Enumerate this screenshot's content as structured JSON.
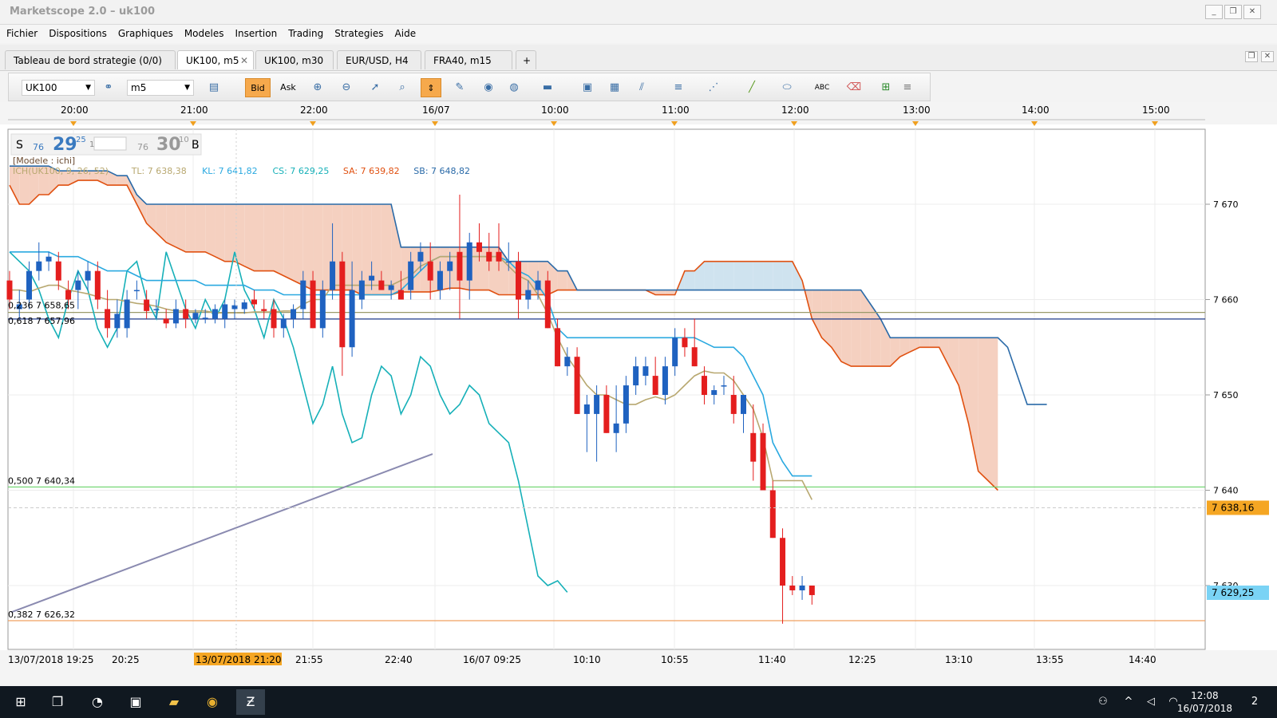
{
  "window": {
    "title": "Marketscope 2.0 – uk100",
    "min_symbol": "_",
    "restore_symbol": "❐",
    "close_symbol": "✕"
  },
  "menu": [
    "Fichier",
    "Dispositions",
    "Graphiques",
    "Modeles",
    "Insertion",
    "Trading",
    "Strategies",
    "Aide"
  ],
  "tabs": [
    {
      "label": "Tableau de bord strategie (0/0)",
      "active": false
    },
    {
      "label": "UK100, m5",
      "active": true,
      "close": "✕"
    },
    {
      "label": "UK100, m30",
      "active": false
    },
    {
      "label": "EUR/USD, H4",
      "active": false
    },
    {
      "label": "FRA40, m15",
      "active": false
    }
  ],
  "add_tab": "+",
  "toolbar": {
    "instrument": "UK100",
    "timeframe": "m5",
    "bid_label": "Bid",
    "ask_label": "Ask"
  },
  "quote": {
    "sell_label": "S",
    "sell_small": "76",
    "sell_big": "29",
    "sell_sup": "25",
    "spread": "1",
    "buy_small": "76",
    "buy_big": "30",
    "buy_sup": "10",
    "buy_label": "B"
  },
  "model_label": "[Modele : ichi]",
  "indicator": {
    "name": "ICH(UK100, 9, 26, 52)",
    "tl": "TL: 7 638,38",
    "kl": "KL: 7 641,82",
    "cs": "CS: 7 629,25",
    "sa": "SA: 7 639,82",
    "sb": "SB: 7 648,82"
  },
  "fib_labels": {
    "f236": "0,236 7 658,65",
    "f618": "0,618 7 657,96",
    "f500": "0,500 7 640,34",
    "f382": "0,382 7 626,32"
  },
  "price_badges": {
    "last": "7 638,16",
    "cs": "7 629,25"
  },
  "colors": {
    "bull": "#1f62c0",
    "bear": "#e41e1e",
    "tenkan": "#b8a870",
    "kijun": "#2aa9e0",
    "chikou": "#16b0b8",
    "spanA": "#e05010",
    "spanB": "#2a6aa8",
    "cloud_bear": "#f5d0c0",
    "cloud_bull": "#cfe3ef",
    "fib500": "#6ad36a",
    "fib382": "#f0a060",
    "fib_blue": "#1e3a8a",
    "fib_olive": "#9a9a6a",
    "trend": "#8a8ab0",
    "last_badge": "#f5a623",
    "cs_badge": "#7ad3f5"
  },
  "top_axis": [
    "20:00",
    "21:00",
    "22:00",
    "16/07",
    "10:00",
    "11:00",
    "12:00",
    "13:00",
    "14:00",
    "15:00"
  ],
  "bottom_axis": [
    "13/07/2018 19:25",
    "20:25",
    "13/07/2018 21:20",
    "21:55",
    "22:40",
    "16/07 09:25",
    "10:10",
    "10:55",
    "11:40",
    "12:25",
    "13:10",
    "13:55",
    "14:40"
  ],
  "chart_data": {
    "type": "candlestick",
    "instrument": "UK100",
    "timeframe": "m5",
    "ylim": [
      7622,
      7680
    ],
    "y_ticks": [
      "7 670",
      "7 660",
      "7 650",
      "7 640",
      "7 630"
    ],
    "y_tick_values": [
      7670,
      7660,
      7650,
      7640,
      7630
    ],
    "fib_levels": [
      7658.65,
      7657.96,
      7640.34,
      7626.32
    ],
    "candles": [
      [
        7662,
        7663,
        7659,
        7660
      ],
      [
        7659,
        7661,
        7658,
        7659.5
      ],
      [
        7660,
        7664,
        7659,
        7663
      ],
      [
        7663,
        7666,
        7662,
        7664
      ],
      [
        7664,
        7665,
        7663,
        7664.5
      ],
      [
        7664,
        7665,
        7661,
        7662
      ],
      [
        7661,
        7662,
        7659,
        7660
      ],
      [
        7661,
        7663,
        7659,
        7662
      ],
      [
        7662,
        7664,
        7661,
        7663
      ],
      [
        7663,
        7664,
        7659,
        7660
      ],
      [
        7659,
        7661,
        7656,
        7657
      ],
      [
        7657,
        7660,
        7656,
        7658.5
      ],
      [
        7657,
        7661,
        7656,
        7660
      ],
      [
        7661,
        7662,
        7660,
        7661
      ],
      [
        7660,
        7661,
        7658,
        7658.8
      ],
      [
        7659,
        7660,
        7658,
        7659
      ],
      [
        7658,
        7659,
        7657,
        7657.5
      ],
      [
        7657.5,
        7660,
        7657,
        7659
      ],
      [
        7659,
        7660,
        7657,
        7658
      ],
      [
        7658,
        7659,
        7657.5,
        7658.6
      ],
      [
        7658,
        7659,
        7657.5,
        7658.1
      ],
      [
        7658,
        7659.5,
        7657.5,
        7659
      ],
      [
        7658,
        7660,
        7657,
        7659.5
      ],
      [
        7659,
        7660,
        7658,
        7659.4
      ],
      [
        7659,
        7660,
        7658.5,
        7659.7
      ],
      [
        7660,
        7661,
        7659,
        7659.5
      ],
      [
        7659,
        7660,
        7658,
        7658.8
      ],
      [
        7659,
        7660,
        7656,
        7657
      ],
      [
        7657,
        7658.5,
        7656,
        7658
      ],
      [
        7658,
        7659.5,
        7657,
        7659
      ],
      [
        7659,
        7663,
        7658,
        7662
      ],
      [
        7662,
        7663,
        7657,
        7657
      ],
      [
        7657,
        7662,
        7656,
        7661
      ],
      [
        7661,
        7668,
        7660,
        7664
      ],
      [
        7664,
        7665,
        7652,
        7655
      ],
      [
        7655,
        7664,
        7654,
        7661
      ],
      [
        7660,
        7663,
        7659,
        7662
      ],
      [
        7662,
        7664,
        7661,
        7662.5
      ],
      [
        7662,
        7663,
        7661,
        7661
      ],
      [
        7661,
        7662,
        7660,
        7661.5
      ],
      [
        7661,
        7663,
        7660,
        7660
      ],
      [
        7661,
        7665,
        7660,
        7664
      ],
      [
        7664,
        7666,
        7663,
        7665
      ],
      [
        7664,
        7666,
        7660,
        7662
      ],
      [
        7661,
        7664,
        7660,
        7663
      ],
      [
        7663,
        7665,
        7661,
        7664
      ],
      [
        7665,
        7671,
        7658,
        7662
      ],
      [
        7662,
        7667,
        7660,
        7666
      ],
      [
        7666,
        7668,
        7664,
        7665
      ],
      [
        7665,
        7667,
        7663,
        7664
      ],
      [
        7665,
        7668,
        7663,
        7664
      ],
      [
        7664,
        7666,
        7663,
        7664
      ],
      [
        7664,
        7665,
        7658,
        7660
      ],
      [
        7660,
        7662,
        7659,
        7661
      ],
      [
        7661,
        7663,
        7660,
        7662
      ],
      [
        7662,
        7663,
        7657,
        7657
      ],
      [
        7657,
        7658,
        7653,
        7653
      ],
      [
        7653,
        7655,
        7652,
        7654
      ],
      [
        7654,
        7655,
        7648,
        7648
      ],
      [
        7648,
        7650,
        7644,
        7649
      ],
      [
        7648,
        7651,
        7643,
        7650
      ],
      [
        7650,
        7651,
        7646,
        7646
      ],
      [
        7646,
        7651,
        7644,
        7647
      ],
      [
        7647,
        7652,
        7646,
        7651
      ],
      [
        7651,
        7654,
        7650,
        7653
      ],
      [
        7652,
        7654,
        7651,
        7653
      ],
      [
        7652,
        7654,
        7650,
        7650
      ],
      [
        7650,
        7654,
        7649,
        7653
      ],
      [
        7653,
        7657,
        7652,
        7656
      ],
      [
        7656,
        7657,
        7654,
        7655
      ],
      [
        7655,
        7658,
        7653,
        7653
      ],
      [
        7652,
        7653,
        7649,
        7650
      ],
      [
        7650,
        7651,
        7649,
        7650.5
      ],
      [
        7651,
        7652,
        7650,
        7651
      ],
      [
        7650,
        7652,
        7647,
        7648
      ],
      [
        7648,
        7650,
        7646,
        7650
      ],
      [
        7646,
        7649,
        7641,
        7643
      ],
      [
        7646,
        7647,
        7640,
        7640
      ],
      [
        7640,
        7641,
        7635,
        7635
      ],
      [
        7635,
        7636,
        7626,
        7630
      ],
      [
        7630,
        7631,
        7629,
        7629.5
      ],
      [
        7629.5,
        7631,
        7628.5,
        7630
      ],
      [
        7630,
        7630,
        7628,
        7629
      ]
    ],
    "tenkan_sen": [
      7661,
      7661,
      7660.8,
      7661.2,
      7661.5,
      7661.5,
      7661,
      7660.8,
      7660.6,
      7660.3,
      7660,
      7660,
      7659.8,
      7659.6,
      7659.5,
      7659.3,
      7659,
      7658.8,
      7658.8,
      7658.8,
      7658.8,
      7658.6,
      7658.6,
      7658.6,
      7658.6,
      7658.7,
      7658.7,
      7658.7,
      7658.8,
      7658.8,
      7659.5,
      7660,
      7660,
      7661.5,
      7661.5,
      7661.5,
      7661.5,
      7661.5,
      7661.5,
      7661.5,
      7662,
      7662.5,
      7663.5,
      7664,
      7664.5,
      7664.5,
      7664.5,
      7664.5,
      7664.5,
      7664.5,
      7664.5,
      7663.5,
      7662.5,
      7662,
      7660.5,
      7658.5,
      7656,
      7654,
      7652.5,
      7651,
      7650,
      7650,
      7649.5,
      7649,
      7649,
      7649.5,
      7649.8,
      7649.5,
      7650,
      7651,
      7652,
      7652.5,
      7652.3,
      7652.3,
      7651.5,
      7650,
      7648.5,
      7645.5,
      7641,
      7641,
      7641,
      7641,
      7639
    ],
    "kijun_sen": [
      7665,
      7665,
      7665,
      7665,
      7665,
      7664.5,
      7664.5,
      7664.5,
      7664,
      7663.5,
      7663,
      7663,
      7663,
      7662.5,
      7662,
      7662,
      7662,
      7662,
      7662,
      7662,
      7661.5,
      7661.5,
      7661.5,
      7661.5,
      7661.5,
      7661,
      7661,
      7661,
      7660.5,
      7660.5,
      7660.5,
      7660.5,
      7660.5,
      7660.5,
      7660.5,
      7660.5,
      7660.5,
      7660.5,
      7660.5,
      7660.5,
      7661,
      7662,
      7663,
      7664,
      7664.5,
      7664.5,
      7664.5,
      7664.5,
      7664.5,
      7664.5,
      7664.5,
      7664,
      7663,
      7662.5,
      7661.5,
      7660,
      7657,
      7656,
      7656,
      7656,
      7656,
      7656,
      7656,
      7656,
      7656,
      7656,
      7656,
      7656,
      7656,
      7656,
      7656,
      7655.5,
      7655,
      7655,
      7655,
      7654,
      7652,
      7650,
      7645,
      7643,
      7641.5,
      7641.5,
      7641.5
    ],
    "chikou_span": [
      7665,
      7664,
      7663,
      7661,
      7658,
      7656,
      7660,
      7663,
      7661,
      7657,
      7655,
      7657,
      7663,
      7664,
      7660,
      7658,
      7665,
      7662,
      7659,
      7657,
      7660,
      7658,
      7660,
      7665,
      7661,
      7659,
      7656,
      7660,
      7658,
      7655,
      7651,
      7647,
      7649,
      7653,
      7648,
      7645,
      7645.5,
      7650,
      7653,
      7652,
      7648,
      7650,
      7654,
      7653,
      7650,
      7648,
      7649,
      7651,
      7650,
      7647,
      7646,
      7645,
      7641,
      7636,
      7631,
      7630,
      7630.5,
      7629.3
    ],
    "senkou_span_a": [
      7672,
      7670,
      7670,
      7671,
      7671,
      7672,
      7672,
      7672.5,
      7672.5,
      7672.5,
      7672,
      7672,
      7672,
      7670,
      7668,
      7667,
      7666,
      7665.5,
      7665,
      7665,
      7665,
      7664.5,
      7664,
      7664,
      7663.5,
      7663,
      7663,
      7663,
      7662.5,
      7662,
      7661.5,
      7661,
      7661,
      7661,
      7661,
      7661,
      7660.5,
      7660.5,
      7660.5,
      7660.5,
      7660.8,
      7660.8,
      7660.8,
      7660.8,
      7661,
      7661.2,
      7661.2,
      7661,
      7661,
      7661,
      7660.5,
      7660.5,
      7660.5,
      7660.5,
      7660.5,
      7660.5,
      7661,
      7661,
      7661,
      7661,
      7661,
      7661,
      7661,
      7661,
      7661,
      7661,
      7660.5,
      7660.5,
      7660.5,
      7663,
      7663,
      7664,
      7664,
      7664,
      7664,
      7664,
      7664,
      7664,
      7664,
      7664,
      7664,
      7662,
      7658,
      7656,
      7655,
      7653.5,
      7653,
      7653,
      7653,
      7653,
      7653,
      7654,
      7654.5,
      7655,
      7655,
      7655,
      7653,
      7651,
      7647,
      7642,
      7641,
      7640
    ],
    "senkou_span_b": [
      7674,
      7674,
      7674,
      7674,
      7674,
      7673.5,
      7673.5,
      7673.5,
      7673.5,
      7673.5,
      7673.5,
      7673,
      7673,
      7671,
      7670,
      7670,
      7670,
      7670,
      7670,
      7670,
      7670,
      7670,
      7670,
      7670,
      7670,
      7670,
      7670,
      7670,
      7670,
      7670,
      7670,
      7670,
      7670,
      7670,
      7670,
      7670,
      7670,
      7670,
      7670,
      7670,
      7665.5,
      7665.5,
      7665.5,
      7665.5,
      7665.5,
      7665.5,
      7665.5,
      7665.5,
      7665.5,
      7665.5,
      7665.5,
      7664,
      7664,
      7664,
      7664,
      7664,
      7663,
      7663,
      7661,
      7661,
      7661,
      7661,
      7661,
      7661,
      7661,
      7661,
      7661,
      7661,
      7661,
      7661,
      7661,
      7661,
      7661,
      7661,
      7661,
      7661,
      7661,
      7661,
      7661,
      7661,
      7661,
      7661,
      7661,
      7661,
      7661,
      7661,
      7661,
      7661,
      7659.5,
      7658,
      7656,
      7656,
      7656,
      7656,
      7656,
      7656,
      7656,
      7656,
      7656,
      7656,
      7656,
      7656,
      7655,
      7652,
      7649,
      7649,
      7649
    ]
  },
  "taskbar": {
    "clock_time": "12:08",
    "clock_date": "16/07/2018",
    "notif_count": "2"
  }
}
